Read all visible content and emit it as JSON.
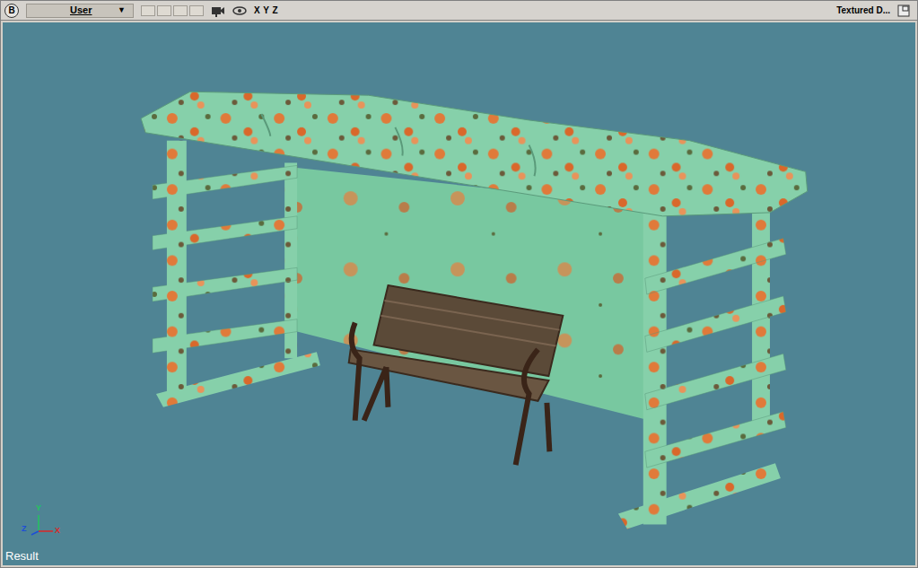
{
  "header": {
    "menu_button": "B",
    "view": {
      "label": "User",
      "arrow": "▼"
    },
    "view_slots": [
      false,
      false,
      false,
      false
    ],
    "axes_label": "X Y Z",
    "shading": "Textured D..."
  },
  "viewport": {
    "gizmo": [
      {
        "label": "Y",
        "color": "#22c55e"
      },
      {
        "label": "Z",
        "color": "#1d4ed8"
      },
      {
        "label": "X",
        "color": "#dc2626"
      }
    ],
    "status": "Result"
  }
}
